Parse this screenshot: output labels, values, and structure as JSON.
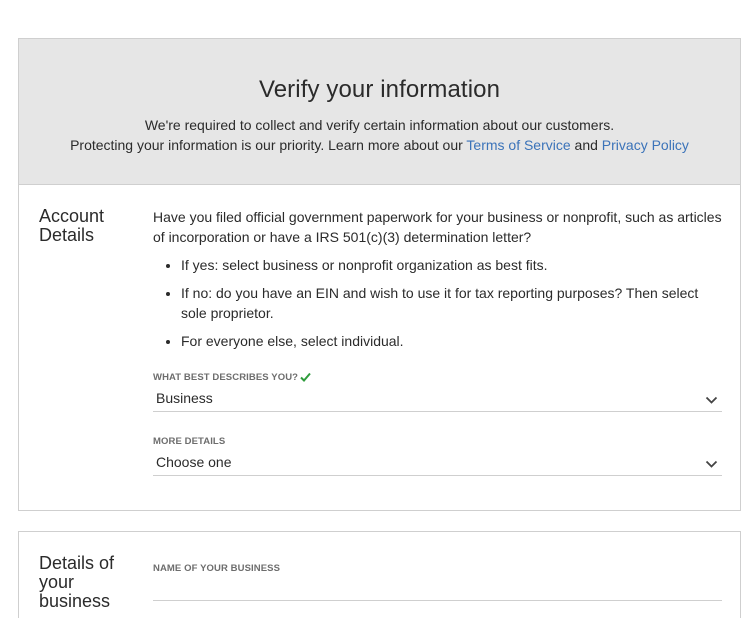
{
  "header": {
    "title": "Verify your information",
    "line1": "We're required to collect and verify certain information about our customers.",
    "line2_prefix": "Protecting your information is our priority. Learn more about our ",
    "terms_link": "Terms of Service",
    "and_text": " and ",
    "privacy_link": "Privacy Policy"
  },
  "account": {
    "title": "Account Details",
    "question": "Have you filed official government paperwork for your business or nonprofit, such as articles of incorporation or have a IRS 501(c)(3) determination letter?",
    "bullets": [
      "If yes: select business or nonprofit organization as best fits.",
      "If no: do you have an EIN and wish to use it for tax reporting purposes? Then select sole proprietor.",
      "For everyone else, select individual."
    ],
    "describe_label": "WHAT BEST DESCRIBES YOU?",
    "describe_value": "Business",
    "more_label": "MORE DETAILS",
    "more_value": "Choose one"
  },
  "business": {
    "title": "Details of your business",
    "name_label": "NAME OF YOUR BUSINESS",
    "name_value": ""
  },
  "colors": {
    "link": "#3b73b9",
    "check": "#2e9c3c",
    "header_bg": "#e6e6e6"
  }
}
